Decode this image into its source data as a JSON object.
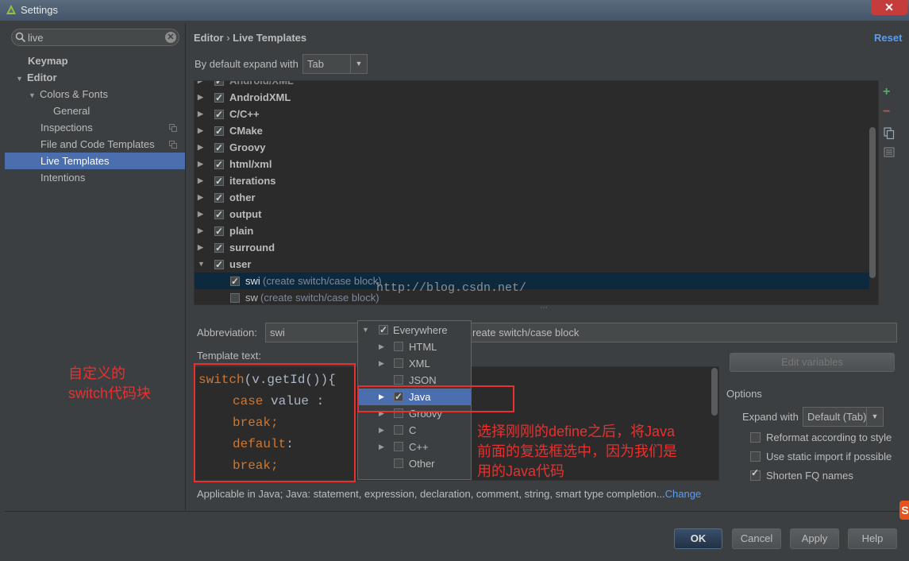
{
  "window": {
    "title": "Settings",
    "close_icon": "close-icon"
  },
  "search": {
    "value": "live"
  },
  "nav": {
    "items": [
      {
        "label": "Keymap"
      },
      {
        "label": "Editor"
      },
      {
        "label": "Colors & Fonts"
      },
      {
        "label": "General"
      },
      {
        "label": "Inspections"
      },
      {
        "label": "File and Code Templates"
      },
      {
        "label": "Live Templates"
      },
      {
        "label": "Intentions"
      }
    ]
  },
  "header": {
    "crumb_parent": "Editor",
    "crumb_sep": "›",
    "crumb_current": "Live Templates",
    "reset": "Reset"
  },
  "expand": {
    "label": "By default expand with",
    "value": "Tab"
  },
  "groups": [
    {
      "label": "AndroidXML"
    },
    {
      "label": "C/C++"
    },
    {
      "label": "CMake"
    },
    {
      "label": "Groovy"
    },
    {
      "label": "html/xml"
    },
    {
      "label": "iterations"
    },
    {
      "label": "other"
    },
    {
      "label": "output"
    },
    {
      "label": "plain"
    },
    {
      "label": "surround"
    },
    {
      "label": "user"
    }
  ],
  "templates": [
    {
      "abbr": "swi",
      "desc": "(create switch/case block)"
    },
    {
      "abbr": "sw",
      "desc": "(create switch/case block)"
    }
  ],
  "watermark": "http://blog.csdn.net/",
  "form": {
    "abbreviation_label": "Abbreviation:",
    "abbreviation_value": "swi",
    "description_value": "reate switch/case block",
    "template_text_label": "Template text:",
    "edit_variables": "Edit variables",
    "options_label": "Options",
    "expand_with_label": "Expand with",
    "expand_with_value": "Default (Tab)",
    "reformat": "Reformat according to style",
    "static_import": "Use static import if possible",
    "shorten_fq": "Shorten FQ names",
    "applicable": "Applicable in Java; Java: statement, expression, declaration, comment, string, smart type completion...",
    "change": "Change"
  },
  "code": {
    "l1_kw": "switch",
    "l1_rest": "(v.getId()){",
    "l2_kw": "case",
    "l2_rest": " value :",
    "l3": "break;",
    "l4_kw": "default",
    "l4_rest": ":",
    "l5": "break;"
  },
  "contexts": [
    {
      "label": "Everywhere"
    },
    {
      "label": "HTML"
    },
    {
      "label": "XML"
    },
    {
      "label": "JSON"
    },
    {
      "label": "Java"
    },
    {
      "label": "Groovy"
    },
    {
      "label": "C"
    },
    {
      "label": "C++"
    },
    {
      "label": "Other"
    }
  ],
  "annotations": {
    "left_l1": "自定义的",
    "left_l2": "switch代码块",
    "right_l1": "选择刚刚的define之后，将Java",
    "right_l2": "前面的复选框选中，因为我们是",
    "right_l3": "用的Java代码"
  },
  "buttons": {
    "ok": "OK",
    "cancel": "Cancel",
    "apply": "Apply",
    "help": "Help"
  },
  "colors": {
    "accent": "#4b6eaf",
    "annotation": "#e8312f",
    "keyword": "#cc7832"
  }
}
